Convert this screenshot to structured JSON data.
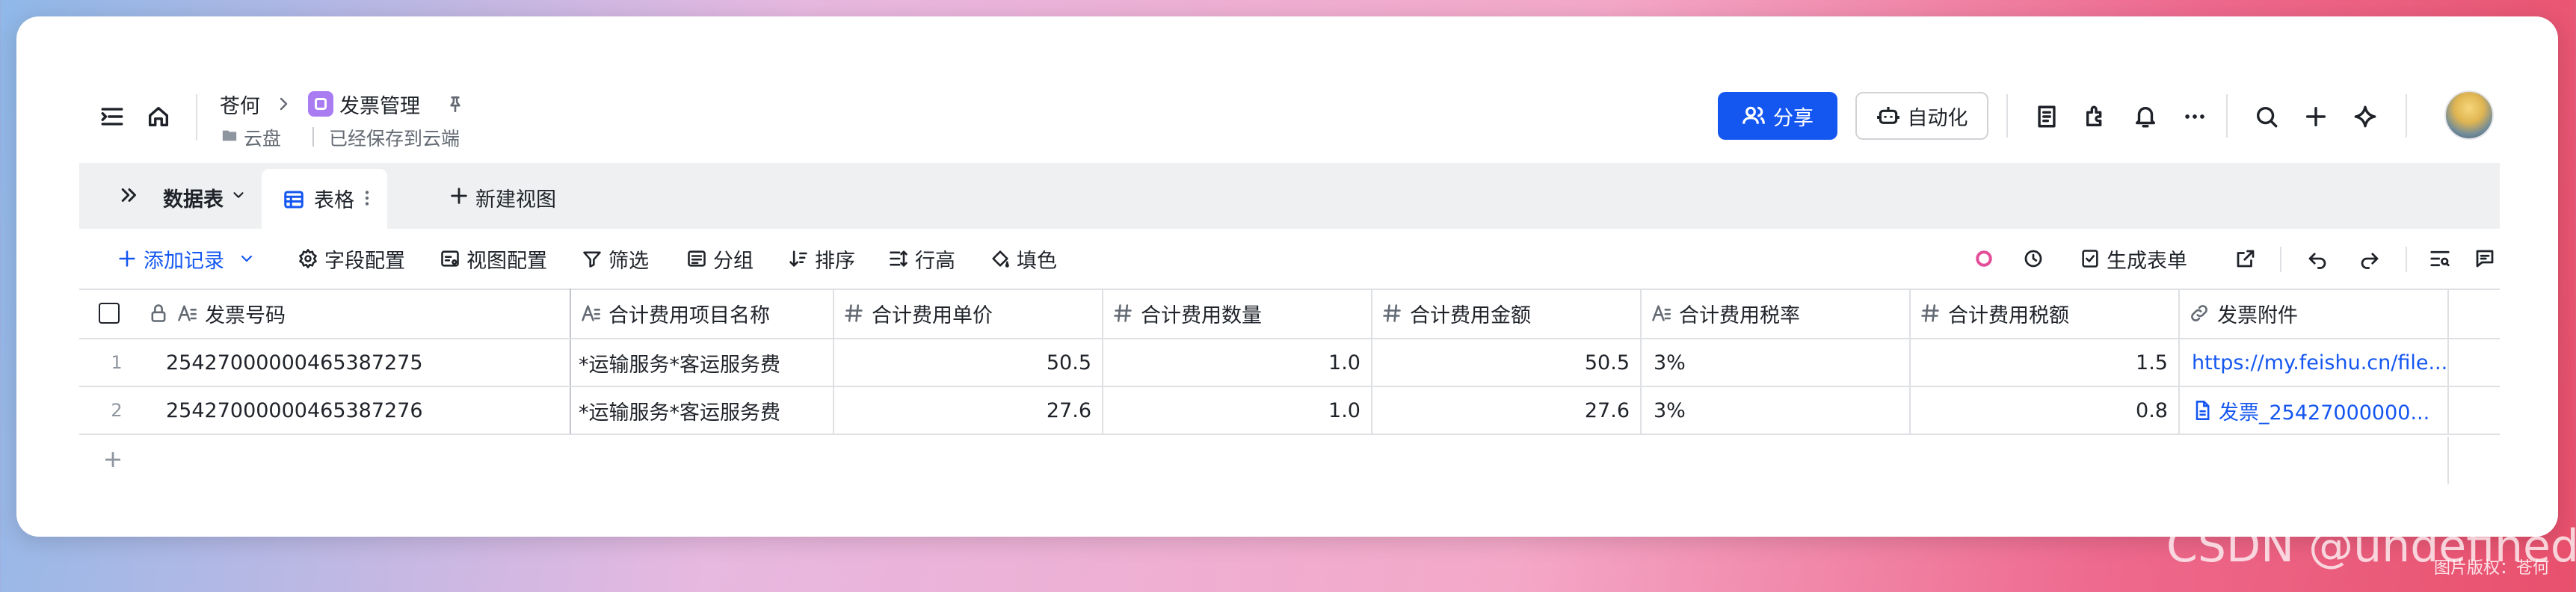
{
  "breadcrumb": {
    "workspace": "苍何",
    "doc_title": "发票管理",
    "location": "云盘",
    "save_status": "已经保存到云端"
  },
  "header": {
    "share_label": "分享",
    "automation_label": "自动化"
  },
  "tabbar": {
    "table_menu_label": "数据表",
    "active_view_label": "表格",
    "new_view_label": "新建视图"
  },
  "toolbar": {
    "add_record_label": "添加记录",
    "field_config_label": "字段配置",
    "view_config_label": "视图配置",
    "filter_label": "筛选",
    "group_label": "分组",
    "sort_label": "排序",
    "row_height_label": "行高",
    "fill_color_label": "填色",
    "generate_form_label": "生成表单"
  },
  "table": {
    "columns": [
      {
        "label": "发票号码",
        "type": "text"
      },
      {
        "label": "合计费用项目名称",
        "type": "text"
      },
      {
        "label": "合计费用单价",
        "type": "number"
      },
      {
        "label": "合计费用数量",
        "type": "number"
      },
      {
        "label": "合计费用金额",
        "type": "number"
      },
      {
        "label": "合计费用税率",
        "type": "text"
      },
      {
        "label": "合计费用税额",
        "type": "number"
      },
      {
        "label": "发票附件",
        "type": "link"
      }
    ],
    "rows": [
      {
        "no": "1",
        "cells": [
          "25427000000465387275",
          "*运输服务*客运服务费",
          "50.5",
          "1.0",
          "50.5",
          "3%",
          "1.5",
          "https://my.feishu.cn/file..."
        ]
      },
      {
        "no": "2",
        "cells": [
          "25427000000465387276",
          "*运输服务*客运服务费",
          "27.6",
          "1.0",
          "27.6",
          "3%",
          "0.8",
          "发票_25427000000..."
        ]
      }
    ]
  },
  "watermark": {
    "text": "CSDN @undefined",
    "small_text": "图片版权：苍何"
  }
}
